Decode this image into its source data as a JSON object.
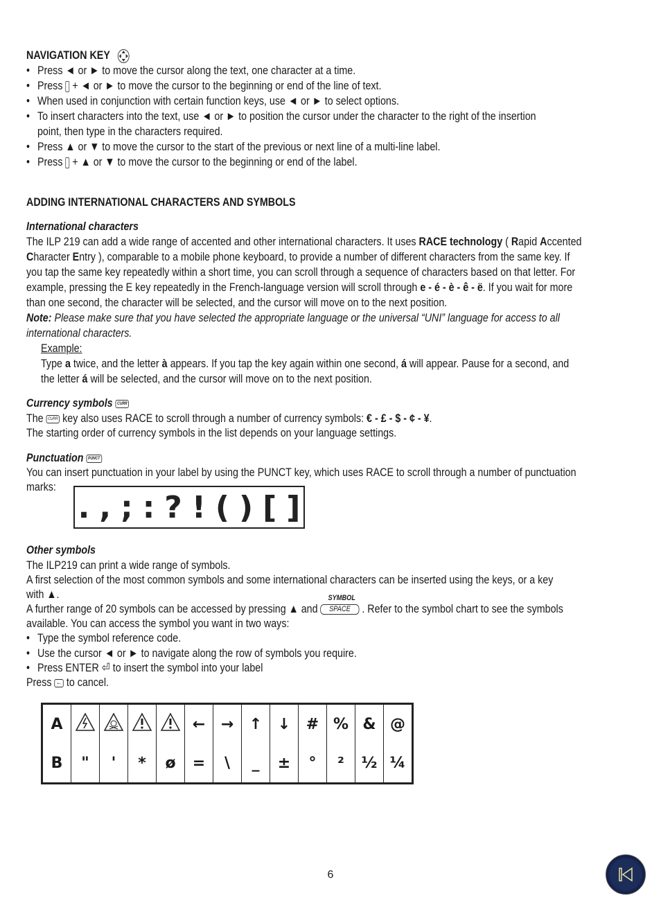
{
  "navigation": {
    "heading": "NAVIGATION KEY",
    "bullets": [
      "Press ◄ or ►  to move the cursor along the text, one character at a time.",
      [
        "Press ",
        " + ◄ or ►   to move the cursor to the beginning or end of the line of text."
      ],
      "When used in conjunction with certain function keys, use  ◄ or ►   to select options.",
      "To insert characters into the text, use  ◄ or ► to position the cursor under the character to the right of the insertion",
      "point, then type in the characters required.",
      "Press ▲ or ▼ to move the cursor to the start of the previous or next line of a multi-line label.",
      [
        "Press ",
        " + ▲ or ▼  to move the cursor to the beginning or end of the label."
      ]
    ]
  },
  "international": {
    "heading": "ADDING INTERNATIONAL CHARACTERS AND SYMBOLS",
    "subheading": "International characters",
    "p1_l1a": "The ILP 219 can add a wide range of accented and other international characters. It uses ",
    "p1_l1b": "RACE technology",
    "p1_l1c": " ( ",
    "p1_l1d": "R",
    "p1_l1e": "apid ",
    "p1_l1f": "A",
    "p1_l1g": "ccented",
    "p1_l2a": "C",
    "p1_l2b": "haracter ",
    "p1_l2c": "E",
    "p1_l2d": "ntry ), comparable to a mobile phone keyboard, to provide a number of different characters from the same key. If",
    "p1_l3": "you tap the same key repeatedly within a short time, you can scroll through a sequence of characters based on that letter. For",
    "p1_l4a": "example, pressing the E key repeatedly in the French-language version will scroll through ",
    "p1_l4b": "e - é - è - ê - ë",
    "p1_l4c": ". If you wait for more",
    "p1_l5": "than one second, the character will be selected, and the cursor will move on to the next position.",
    "note_label": "Note:",
    "note_l1": " Please make sure that you have selected the appropriate  language or the universal “UNI” language for access to all",
    "note_l2": "international characters.",
    "example_label": "Example:",
    "ex_l1a": "Type ",
    "ex_l1b": "a",
    "ex_l1c": " twice, and the letter ",
    "ex_l1d": "à",
    "ex_l1e": " appears. If you tap the key again within one second, ",
    "ex_l1f": "á",
    "ex_l1g": " will appear. Pause for a second, and",
    "ex_l2a": "the letter ",
    "ex_l2b": "á",
    "ex_l2c": " will be selected, and the cursor will move on to the next position."
  },
  "currency": {
    "subheading": "Currency symbols",
    "key_label": "CURR",
    "l1a": "The ",
    "l1b": " key also uses RACE to scroll through a number of currency symbols: ",
    "symbols": "€ - £ - $ - ¢ - ¥",
    "l2": "The starting order of currency symbols in the list depends on your language settings."
  },
  "punctuation": {
    "subheading": "Punctuation",
    "key_label": "PUNCT",
    "l1": "You can insert punctuation in your label by using the PUNCT key, which uses RACE to scroll through a number of punctuation",
    "l2": "marks:",
    "marks": [
      ".",
      ",",
      ";",
      ":",
      "?",
      "!",
      "(",
      ")",
      "[",
      "]"
    ]
  },
  "other": {
    "subheading": "Other symbols",
    "l1": "The ILP219 can print a wide range of symbols.",
    "l2": "A first selection of the most common symbols and some international characters can be inserted using the keys, or a key",
    "l3": "with ▲.",
    "l4a": "A further range of 20 symbols can be accessed by pressing  ▲ and ",
    "key_top": "SYMBOL",
    "key_label": "SPACE",
    "l4b": " . Refer to the symbol chart to see the symbols",
    "l5": "available. You can access the symbol you want in two ways:",
    "bullets": [
      "Type the symbol reference code.",
      "Use the cursor ◄  or  ►  to navigate along the row of symbols you require.",
      "Press ENTER  ⏎  to insert the symbol into your label"
    ],
    "cancel_a": "Press ",
    "cancel_b": " to cancel."
  },
  "symbol_table": {
    "rows": [
      [
        "A",
        "⚡-warning",
        "toxic-warning",
        "!-warning",
        "!-warning",
        "←",
        "→",
        "↑",
        "↓",
        "#",
        "%",
        "&",
        "@"
      ],
      [
        "B",
        "\"",
        "'",
        "*",
        "ø",
        "=",
        "\\",
        "_",
        "±",
        "°",
        "²",
        "½",
        "¼"
      ]
    ]
  },
  "footer": {
    "page_number": "6"
  }
}
